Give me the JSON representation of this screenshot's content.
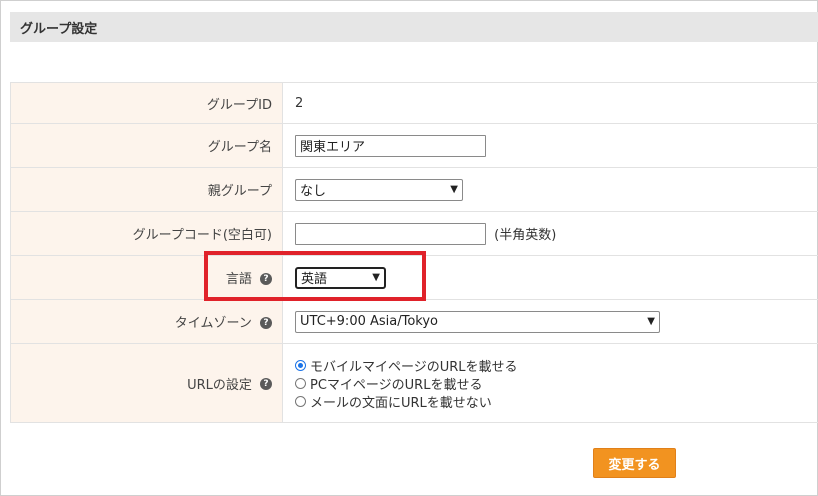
{
  "section": {
    "title": "グループ設定"
  },
  "fields": {
    "group_id": {
      "label": "グループID",
      "value": "2"
    },
    "group_name": {
      "label": "グループ名",
      "value": "関東エリア"
    },
    "parent_group": {
      "label": "親グループ",
      "selected": "なし"
    },
    "group_code": {
      "label": "グループコード(空白可)",
      "value": "",
      "hint": "(半角英数)"
    },
    "language": {
      "label": "言語",
      "selected": "英語"
    },
    "timezone": {
      "label": "タイムゾーン",
      "selected": "UTC+9:00 Asia/Tokyo"
    },
    "url_setting": {
      "label": "URLの設定",
      "options": [
        {
          "label": "モバイルマイページのURLを載せる",
          "checked": true
        },
        {
          "label": "PCマイページのURLを載せる",
          "checked": false
        },
        {
          "label": "メールの文面にURLを載せない",
          "checked": false
        }
      ]
    }
  },
  "actions": {
    "submit_label": "変更する"
  },
  "icons": {
    "help": "question-circle-icon",
    "dropdown": "chevron-down-icon"
  },
  "colors": {
    "label_bg": "#fdf4ec",
    "header_bg": "#e6e6e6",
    "button_bg": "#f29320",
    "highlight": "#e0222a",
    "radio_accent": "#1a73e8"
  }
}
